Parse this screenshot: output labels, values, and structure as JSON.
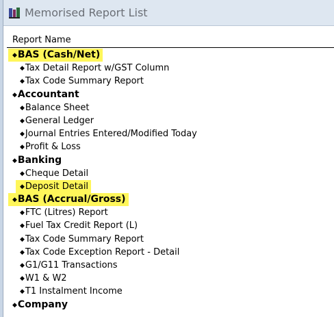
{
  "window": {
    "title": "Memorised Report List"
  },
  "list": {
    "column_header": "Report Name",
    "rows": [
      {
        "kind": "group",
        "label": "BAS (Cash/Net)",
        "highlighted": true
      },
      {
        "kind": "item",
        "label": "Tax Detail Report w/GST Column"
      },
      {
        "kind": "item",
        "label": "Tax Code Summary Report"
      },
      {
        "kind": "group",
        "label": "Accountant"
      },
      {
        "kind": "item",
        "label": "Balance Sheet"
      },
      {
        "kind": "item",
        "label": "General Ledger"
      },
      {
        "kind": "item",
        "label": "Journal Entries Entered/Modified Today"
      },
      {
        "kind": "item",
        "label": "Profit & Loss"
      },
      {
        "kind": "group",
        "label": "Banking"
      },
      {
        "kind": "item",
        "label": "Cheque Detail"
      },
      {
        "kind": "item",
        "label": "Deposit Detail",
        "highlighted": true
      },
      {
        "kind": "group",
        "label": "BAS (Accrual/Gross)",
        "highlighted": true
      },
      {
        "kind": "item",
        "label": "FTC (Litres) Report"
      },
      {
        "kind": "item",
        "label": "Fuel Tax Credit Report (L)"
      },
      {
        "kind": "item",
        "label": "Tax Code Summary Report"
      },
      {
        "kind": "item",
        "label": "Tax Code Exception Report - Detail"
      },
      {
        "kind": "item",
        "label": "G1/G11 Transactions"
      },
      {
        "kind": "item",
        "label": "W1 & W2"
      },
      {
        "kind": "item",
        "label": "T1 Instalment Income"
      },
      {
        "kind": "group",
        "label": "Company"
      }
    ]
  },
  "colors": {
    "highlight": "#fff65a",
    "titlebar": "#dee7f1",
    "title_text": "#6b6f76"
  },
  "icons": {
    "app": "report-list-icon",
    "row_marker": "diamond-icon"
  }
}
